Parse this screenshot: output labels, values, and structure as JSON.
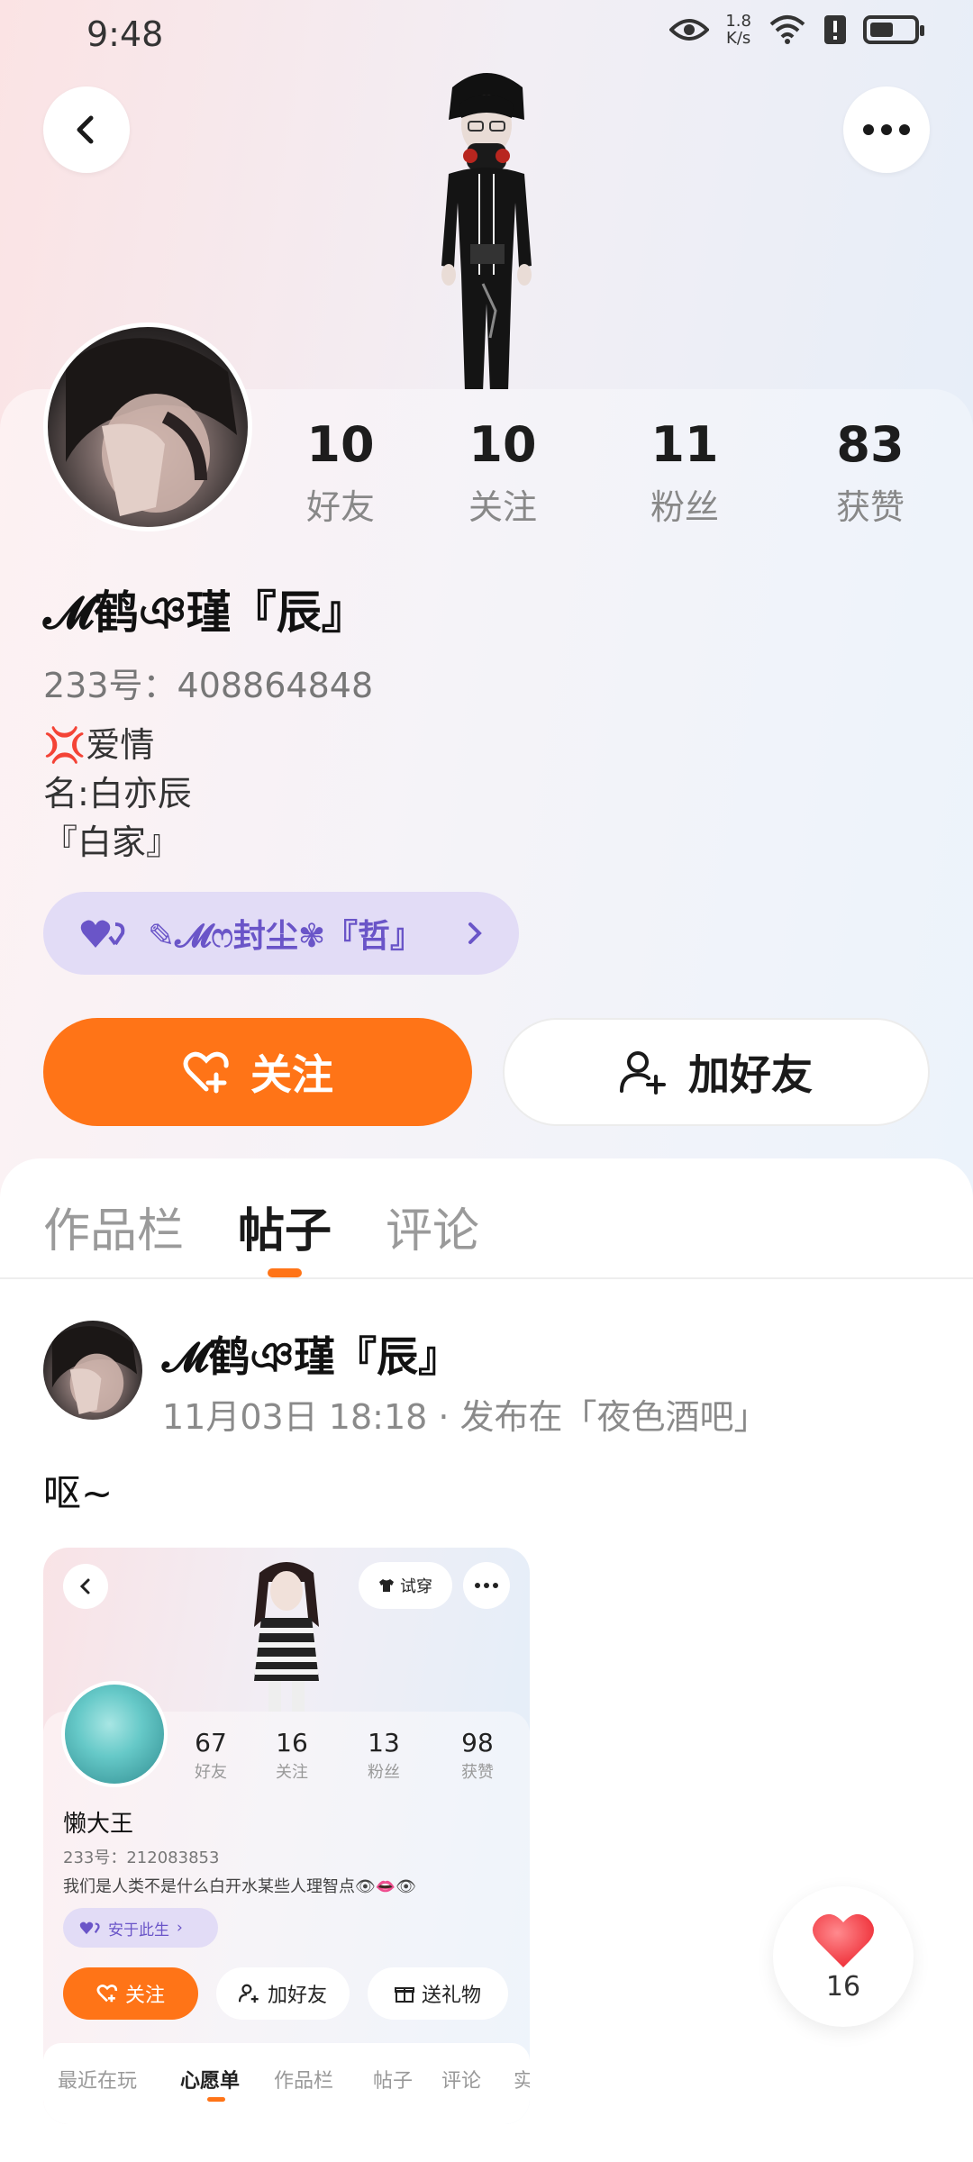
{
  "status_bar": {
    "time": "9:48",
    "speed_value": "1.8",
    "speed_unit": "K/s",
    "battery_level": 0.55
  },
  "profile": {
    "stats": [
      {
        "value": "10",
        "label": "好友"
      },
      {
        "value": "10",
        "label": "关注"
      },
      {
        "value": "11",
        "label": "粉丝"
      },
      {
        "value": "83",
        "label": "获赞"
      }
    ],
    "name": "𝓜鹤ঞ瑾『辰』",
    "uid": "233号：408864848",
    "bio_lines": [
      "爱情",
      "名:白亦辰",
      "『白家』"
    ],
    "cp_pill_text": "✎𝓜ෆ封尘✾『哲』",
    "follow_label": "关注",
    "add_friend_label": "加好友"
  },
  "tabs": [
    "作品栏",
    "帖子",
    "评论"
  ],
  "post": {
    "author": "𝓜鹤ঞ瑾『辰』",
    "meta": "11月03日 18:18 · 发布在「夜色酒吧」",
    "text": "呕~",
    "like_count": "16"
  },
  "embedded_screenshot": {
    "try_on_label": "试穿",
    "stats": [
      {
        "value": "67",
        "label": "好友"
      },
      {
        "value": "16",
        "label": "关注"
      },
      {
        "value": "13",
        "label": "粉丝"
      },
      {
        "value": "98",
        "label": "获赞"
      }
    ],
    "name": "懒大王",
    "uid": "233号：212083853",
    "bio": "我们是人类不是什么白开水某些人理智点👁👄👁",
    "pill_text": "安于此生",
    "follow_label": "关注",
    "add_friend_label": "加好友",
    "gift_label": "送礼物",
    "tabs": [
      "最近在玩",
      "心愿单",
      "作品栏",
      "帖子",
      "评论",
      "实"
    ]
  },
  "colors": {
    "accent": "#ff7417",
    "cp_purple": "#6a55c8",
    "like_red": "#f5444b"
  }
}
